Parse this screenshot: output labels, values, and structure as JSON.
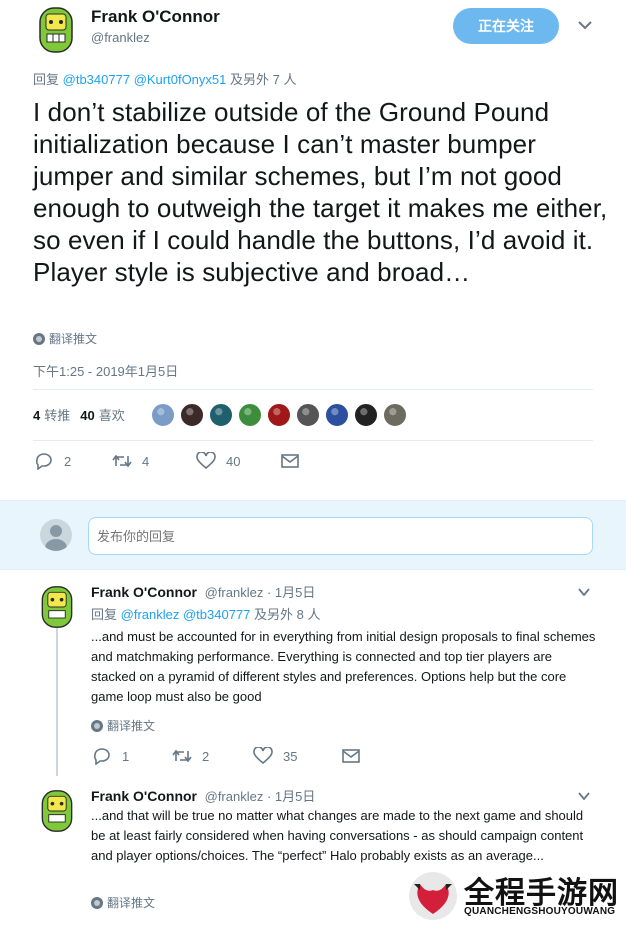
{
  "tweet": {
    "author_name": "Frank O'Connor",
    "author_handle": "@franklez",
    "follow_label": "正在关注",
    "reply_prefix": "回复",
    "reply_mention_1": "@tb340777",
    "reply_mention_2": "@Kurt0fOnyx51",
    "reply_suffix": "及另外 7 人",
    "text": "I don’t stabilize outside of the Ground Pound initialization because I can’t master bumper jumper and similar schemes, but I’m not good enough to outweigh the target it makes me either, so even if I could handle the buttons, I’d avoid it. Player style is subjective and broad…",
    "translate_label": "翻译推文",
    "timestamp": "下午1:25 - 2019年1月5日",
    "retweet_count": "4",
    "retweet_label": "转推",
    "like_count": "40",
    "like_label": "喜欢",
    "actions": {
      "replies": "2",
      "retweets": "4",
      "likes": "40"
    },
    "liker_colors": [
      "#7a9cc6",
      "#3a2a2a",
      "#1f5f6e",
      "#3c8d3c",
      "#a01818",
      "#555555",
      "#2c4fa0",
      "#222222",
      "#6b6b60"
    ]
  },
  "reply_box": {
    "placeholder": "发布你的回复"
  },
  "replies": [
    {
      "author_name": "Frank O'Connor",
      "author_handle": "@franklez",
      "date": "· 1月5日",
      "reply_prefix": "回复",
      "reply_mention_1": "@franklez",
      "reply_mention_2": "@tb340777",
      "reply_suffix": "及另外 8 人",
      "text": "...and must be accounted for in everything from initial design proposals to final schemes and matchmaking performance. Everything is connected and top tier players are stacked on a pyramid of different styles and preferences. Options help but the core game loop must also be good",
      "translate_label": "翻译推文",
      "replies": "1",
      "retweets": "2",
      "likes": "35"
    },
    {
      "author_name": "Frank O'Connor",
      "author_handle": "@franklez",
      "date": "· 1月5日",
      "text": "...and that will be true no matter what changes are made to the next game and should be at least fairly considered when having conversations - as should campaign content and player options/choices. The “perfect” Halo probably exists as an average...",
      "translate_label": "翻译推文"
    }
  ],
  "watermark": {
    "title": "全程手游网",
    "subtitle": "QUANCHENGSHOUYOUWANG"
  },
  "colors": {
    "link": "#1da1f2",
    "muted": "#657786",
    "follow_button": "#6eb8f0",
    "reply_box_bg": "#e8f5fd",
    "avatar_green": "#7ec83a"
  }
}
